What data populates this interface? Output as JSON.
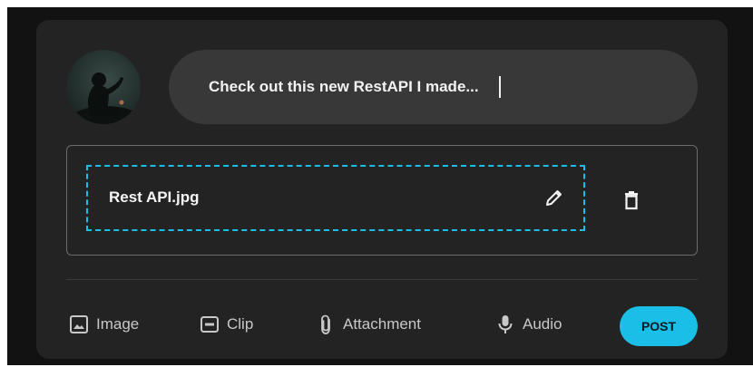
{
  "composer": {
    "value": "Check out this new RestAPI I made..."
  },
  "attachment": {
    "file_name": "Rest API.jpg"
  },
  "toolbar": {
    "items": [
      {
        "label": "Image",
        "icon": "image-icon"
      },
      {
        "label": "Clip",
        "icon": "gif-icon"
      },
      {
        "label": "Attachment",
        "icon": "paperclip-icon"
      },
      {
        "label": "Audio",
        "icon": "microphone-icon"
      }
    ],
    "post_label": "POST"
  },
  "colors": {
    "background": "#121212",
    "card": "#232323",
    "composer": "#383838",
    "accent": "#19bfe6",
    "border": "#6c6c6c",
    "muted_text": "#c8c8c8"
  }
}
